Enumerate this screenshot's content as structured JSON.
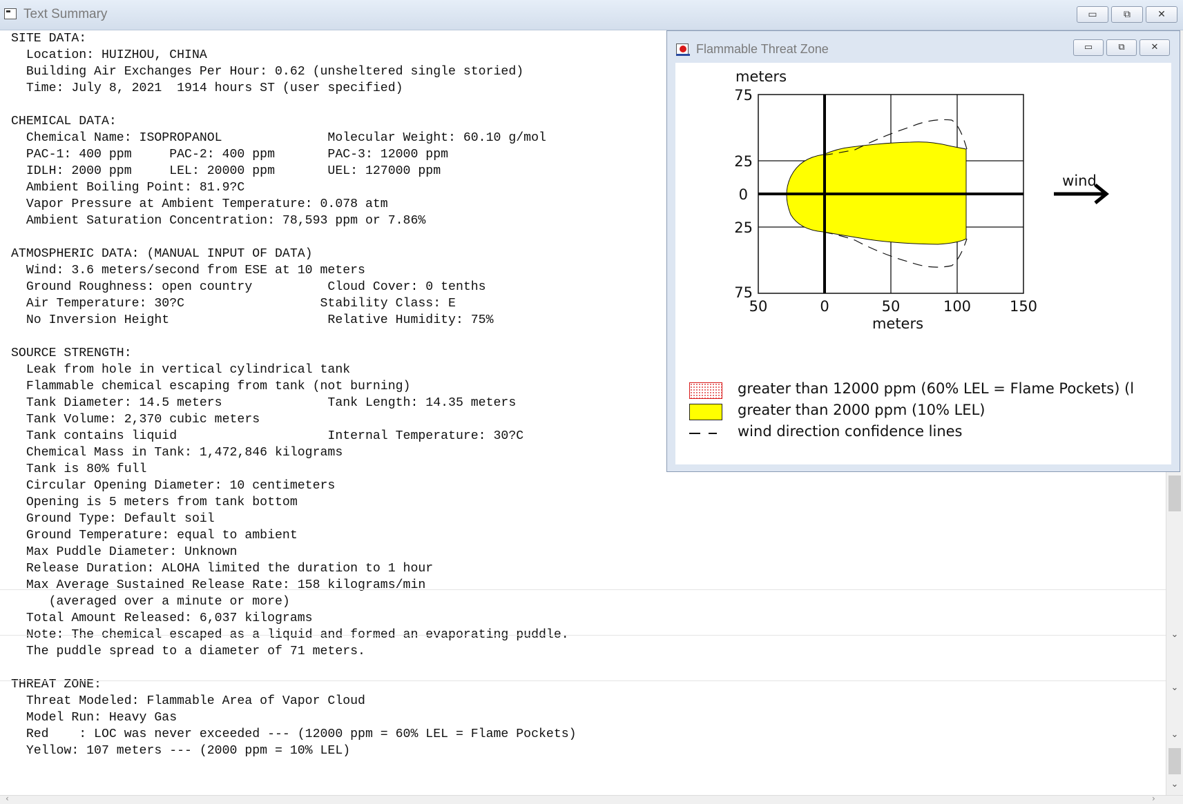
{
  "window": {
    "title": "Text Summary",
    "min_glyph": "▭",
    "max_glyph": "⧉",
    "close_glyph": "✕"
  },
  "report": {
    "text": "SITE DATA:\n  Location: HUIZHOU, CHINA\n  Building Air Exchanges Per Hour: 0.62 (unsheltered single storied)\n  Time: July 8, 2021  1914 hours ST (user specified)\n\nCHEMICAL DATA:\n  Chemical Name: ISOPROPANOL              Molecular Weight: 60.10 g/mol\n  PAC-1: 400 ppm     PAC-2: 400 ppm       PAC-3: 12000 ppm\n  IDLH: 2000 ppm     LEL: 20000 ppm       UEL: 127000 ppm\n  Ambient Boiling Point: 81.9?C\n  Vapor Pressure at Ambient Temperature: 0.078 atm\n  Ambient Saturation Concentration: 78,593 ppm or 7.86%\n\nATMOSPHERIC DATA: (MANUAL INPUT OF DATA)\n  Wind: 3.6 meters/second from ESE at 10 meters\n  Ground Roughness: open country          Cloud Cover: 0 tenths\n  Air Temperature: 30?C                  Stability Class: E\n  No Inversion Height                     Relative Humidity: 75%\n\nSOURCE STRENGTH:\n  Leak from hole in vertical cylindrical tank\n  Flammable chemical escaping from tank (not burning)\n  Tank Diameter: 14.5 meters              Tank Length: 14.35 meters\n  Tank Volume: 2,370 cubic meters\n  Tank contains liquid                    Internal Temperature: 30?C\n  Chemical Mass in Tank: 1,472,846 kilograms\n  Tank is 80% full\n  Circular Opening Diameter: 10 centimeters\n  Opening is 5 meters from tank bottom\n  Ground Type: Default soil\n  Ground Temperature: equal to ambient\n  Max Puddle Diameter: Unknown\n  Release Duration: ALOHA limited the duration to 1 hour\n  Max Average Sustained Release Rate: 158 kilograms/min\n     (averaged over a minute or more)\n  Total Amount Released: 6,037 kilograms\n  Note: The chemical escaped as a liquid and formed an evaporating puddle.\n  The puddle spread to a diameter of 71 meters.\n\nTHREAT ZONE:\n  Threat Modeled: Flammable Area of Vapor Cloud\n  Model Run: Heavy Gas\n  Red    : LOC was never exceeded --- (12000 ppm = 60% LEL = Flame Pockets)\n  Yellow: 107 meters --- (2000 ppm = 10% LEL)"
  },
  "scrollbar": {
    "down_glyph": "⌄",
    "left_glyph": "‹",
    "right_glyph": "›"
  },
  "threat_window": {
    "title": "Flammable Threat Zone",
    "y_unit": "meters",
    "x_unit": "meters",
    "y_ticks": [
      "75",
      "25",
      "0",
      "25",
      "75"
    ],
    "x_ticks": [
      "50",
      "0",
      "50",
      "100",
      "150"
    ],
    "wind_label": "wind",
    "colors": {
      "yellow_zone": "#ffff00",
      "red_zone": "#d81818"
    },
    "legend": [
      {
        "swatch": "red",
        "text": "greater than 12000 ppm (60% LEL = Flame Pockets) (l"
      },
      {
        "swatch": "yellow",
        "text": "greater than 2000 ppm (10% LEL)"
      },
      {
        "swatch": "dash",
        "text": "wind direction confidence lines"
      }
    ]
  }
}
